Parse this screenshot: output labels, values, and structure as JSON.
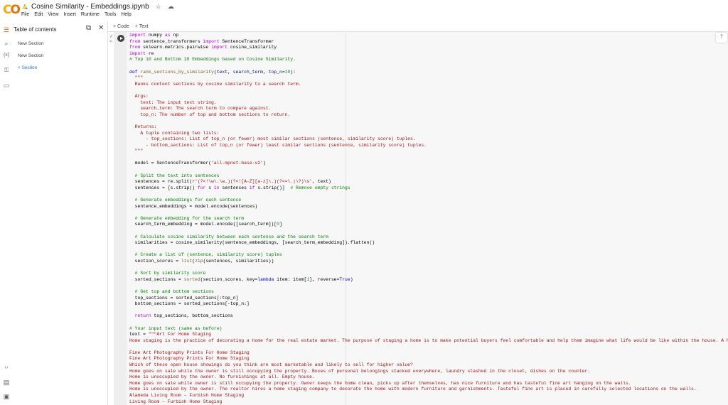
{
  "app": {
    "logo": "CO",
    "title": "Cosine Similarity - Embeddings.ipynb",
    "star_icon": "star-icon",
    "cloud_icon": "cloud-icon"
  },
  "menu": [
    "File",
    "Edit",
    "View",
    "Insert",
    "Runtime",
    "Tools",
    "Help"
  ],
  "toolbar": {
    "add_code": "+ Code",
    "add_text": "+ Text"
  },
  "toc": {
    "title": "Table of contents",
    "items": [
      "New Section",
      "New Section"
    ],
    "add_section": "+ Section"
  },
  "cell": {
    "status": "✓",
    "exec_time": "9s"
  },
  "colors": {
    "keyword": "#af00db",
    "def": "#0000ff",
    "comment": "#008000",
    "string": "#a31515",
    "function": "#795e26",
    "param": "#001080"
  },
  "code_lines": [
    [
      [
        "import",
        "k"
      ],
      [
        " numpy ",
        "n"
      ],
      [
        "as",
        "k"
      ],
      [
        " np",
        "n"
      ]
    ],
    [
      [
        "from",
        "k"
      ],
      [
        " sentence_transformers ",
        "n"
      ],
      [
        "import",
        "k"
      ],
      [
        " SentenceTransformer",
        "n"
      ]
    ],
    [
      [
        "from",
        "k"
      ],
      [
        " sklearn.metrics.pairwise ",
        "n"
      ],
      [
        "import",
        "k"
      ],
      [
        " cosine_similarity",
        "n"
      ]
    ],
    [
      [
        "import",
        "k"
      ],
      [
        " re",
        "n"
      ]
    ],
    [
      [
        "# Top 10 and Bottom 10 Embeddings based on Cosine Similarity.",
        "c"
      ]
    ],
    [],
    [
      [
        "def",
        "d"
      ],
      [
        " ",
        "n"
      ],
      [
        "rank_sections_by_similarity",
        "f"
      ],
      [
        "(",
        "n"
      ],
      [
        "text",
        "p"
      ],
      [
        ", ",
        "n"
      ],
      [
        "search_term",
        "p"
      ],
      [
        ", ",
        "n"
      ],
      [
        "top_n",
        "p"
      ],
      [
        "=",
        "n"
      ],
      [
        "10",
        "num"
      ],
      [
        "):",
        "n"
      ]
    ],
    [
      [
        "  \"\"\"",
        "s"
      ]
    ],
    [
      [
        "  Ranks content sections by cosine similarity to a search term.",
        "s"
      ]
    ],
    [],
    [
      [
        "  Args:",
        "s"
      ]
    ],
    [
      [
        "    text: The input text string.",
        "s"
      ]
    ],
    [
      [
        "    search_term: The search term to compare against.",
        "s"
      ]
    ],
    [
      [
        "    top_n: The number of top and bottom sections to return.",
        "s"
      ]
    ],
    [],
    [
      [
        "  Returns:",
        "s"
      ]
    ],
    [
      [
        "    A tuple containing two lists:",
        "s"
      ]
    ],
    [
      [
        "      - top_sections: List of top_n (or fewer) most similar sections (sentence, similarity score) tuples.",
        "s"
      ]
    ],
    [
      [
        "      - bottom_sections: List of top_n (or fewer) least similar sections (sentence, similarity score) tuples.",
        "s"
      ]
    ],
    [
      [
        "  \"\"\"",
        "s"
      ]
    ],
    [],
    [
      [
        "  model = SentenceTransformer(",
        "n"
      ],
      [
        "'all-mpnet-base-v2'",
        "s"
      ],
      [
        ")",
        "n"
      ]
    ],
    [],
    [
      [
        "  # Split the text into sentences",
        "c"
      ]
    ],
    [
      [
        "  sentences = re.split(",
        "n"
      ],
      [
        "r'(?<!\\w\\.\\w.)(?<![A-Z][a-z]\\.)(?<=\\.|\\?)\\s'",
        "s"
      ],
      [
        ", text)",
        "n"
      ]
    ],
    [
      [
        "  sentences = [s.strip() ",
        "n"
      ],
      [
        "for",
        "k"
      ],
      [
        " s ",
        "n"
      ],
      [
        "in",
        "k"
      ],
      [
        " sentences ",
        "n"
      ],
      [
        "if",
        "k"
      ],
      [
        " s.strip()]  ",
        "n"
      ],
      [
        "# Remove empty strings",
        "c"
      ]
    ],
    [],
    [
      [
        "  # Generate embeddings for each sentence",
        "c"
      ]
    ],
    [
      [
        "  sentence_embeddings = model.encode(sentences)",
        "n"
      ]
    ],
    [],
    [
      [
        "  # Generate embedding for the search term",
        "c"
      ]
    ],
    [
      [
        "  search_term_embedding = model.encode([search_term])[",
        "n"
      ],
      [
        "0",
        "num"
      ],
      [
        "]",
        "n"
      ]
    ],
    [],
    [
      [
        "  # Calculate cosine similarity between each sentence and the search term",
        "c"
      ]
    ],
    [
      [
        "  similarities = cosine_similarity(sentence_embeddings, [search_term_embedding]).flatten()",
        "n"
      ]
    ],
    [],
    [
      [
        "  # Create a list of (sentence, similarity score) tuples",
        "c"
      ]
    ],
    [
      [
        "  section_scores = ",
        "n"
      ],
      [
        "list",
        "f"
      ],
      [
        "(",
        "n"
      ],
      [
        "zip",
        "f"
      ],
      [
        "(sentences, similarities))",
        "n"
      ]
    ],
    [],
    [
      [
        "  # Sort by similarity score",
        "c"
      ]
    ],
    [
      [
        "  sorted_sections = ",
        "n"
      ],
      [
        "sorted",
        "f"
      ],
      [
        "(section_scores, key=",
        "n"
      ],
      [
        "lambda",
        "d"
      ],
      [
        " item: item[",
        "n"
      ],
      [
        "1",
        "num"
      ],
      [
        "], reverse=",
        "n"
      ],
      [
        "True",
        "d"
      ],
      [
        ")",
        "n"
      ]
    ],
    [],
    [
      [
        "  # Get top and bottom sections",
        "c"
      ]
    ],
    [
      [
        "  top_sections = sorted_sections[:top_n]",
        "n"
      ]
    ],
    [
      [
        "  bottom_sections = sorted_sections[-top_n:]",
        "n"
      ]
    ],
    [],
    [
      [
        "  ",
        "n"
      ],
      [
        "return",
        "k"
      ],
      [
        " top_sections, bottom_sections",
        "n"
      ]
    ],
    [],
    [
      [
        "# Your input text (same as before)",
        "c"
      ]
    ],
    [
      [
        "text = ",
        "n"
      ],
      [
        "\"\"\"Art For Home Staging",
        "s"
      ]
    ],
    [
      [
        "Home staging is the practice of decorating a home for the real estate market. The purpose of staging a home is to make potential buyers feel comfortable and help them imagine what life would be like within the house. A home",
        "s"
      ]
    ],
    [],
    [
      [
        "Fine Art Photography Prints For Home Staging",
        "s"
      ]
    ],
    [
      [
        "Fine Art Photography Prints For Home Staging",
        "s"
      ]
    ],
    [
      [
        "Which of these open house showings do you think are most marketable and likely to sell for higher value?",
        "s"
      ]
    ],
    [
      [
        "Home goes on sale while the owner is still occupying the property. Boxes of personal belongings stacked everywhere, laundry stashed in the closet, dishes on the counter.",
        "s"
      ]
    ],
    [
      [
        "Home is unoccupied by the owner. No furnishings at all. Empty house.",
        "s"
      ]
    ],
    [
      [
        "Home goes on sale while owner is still occupying the property. Owner keeps the home clean, picks up after themselves, has nice furniture and has tasteful fine art hanging on the walls.",
        "s"
      ]
    ],
    [
      [
        "Home is unoccupied by the owner. The realtor hires a home staging company to decorate the home with modern furniture and garnishments. Tasteful fine art is placed in carefully selected locations on the walls.",
        "s"
      ]
    ],
    [
      [
        "Alameda Living Room – Furbish Home Staging",
        "s"
      ]
    ],
    [
      [
        "Living Room – Furbish Home Staging",
        "s"
      ]
    ]
  ]
}
